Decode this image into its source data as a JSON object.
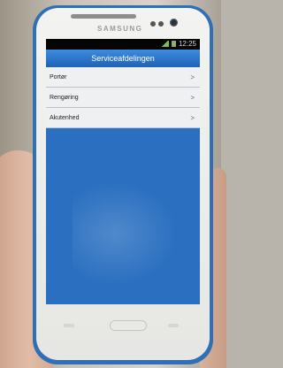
{
  "device": {
    "brand": "SAMSUNG",
    "frame_color": "#2f6fb8"
  },
  "statusbar": {
    "time": "12:25"
  },
  "app": {
    "title": "Serviceafdelingen",
    "accent_color": "#2a6fc0",
    "items": [
      {
        "label": "Portør",
        "chevron": ">"
      },
      {
        "label": "Rengøring",
        "chevron": ">"
      },
      {
        "label": "Akutenhed",
        "chevron": ">"
      }
    ]
  }
}
